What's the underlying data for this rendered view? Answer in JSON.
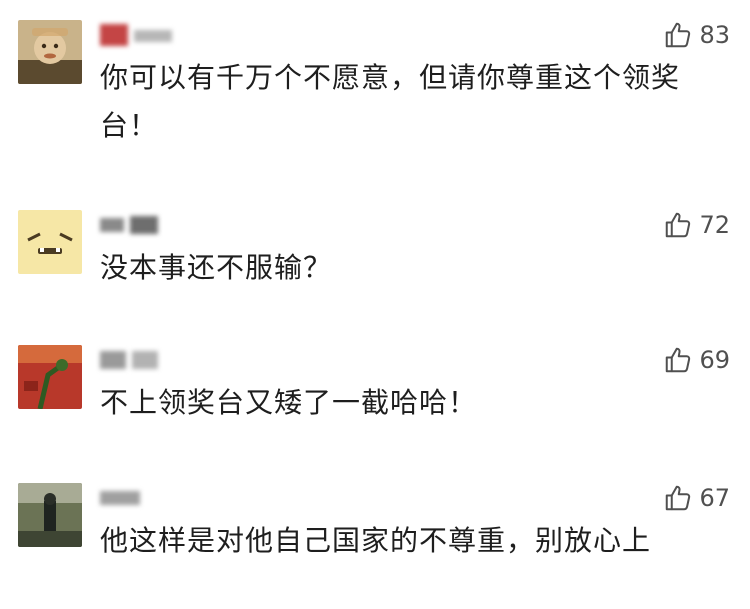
{
  "comments": [
    {
      "avatar": "avatar-1",
      "likes": "83",
      "text": "你可以有千万个不愿意，但请你尊重这个领奖台！",
      "nickname_color": "#c44545"
    },
    {
      "avatar": "avatar-2",
      "likes": "72",
      "text": "没本事还不服输？",
      "nickname_color": "#8a8a8a"
    },
    {
      "avatar": "avatar-3",
      "likes": "69",
      "text": "不上领奖台又矮了一截哈哈！",
      "nickname_color": "#9a9a9a"
    },
    {
      "avatar": "avatar-4",
      "likes": "67",
      "text": "他这样是对他自己国家的不尊重，别放心上",
      "nickname_color": "#a0a0a0"
    }
  ],
  "icons": {
    "like": "thumbs-up-icon"
  }
}
